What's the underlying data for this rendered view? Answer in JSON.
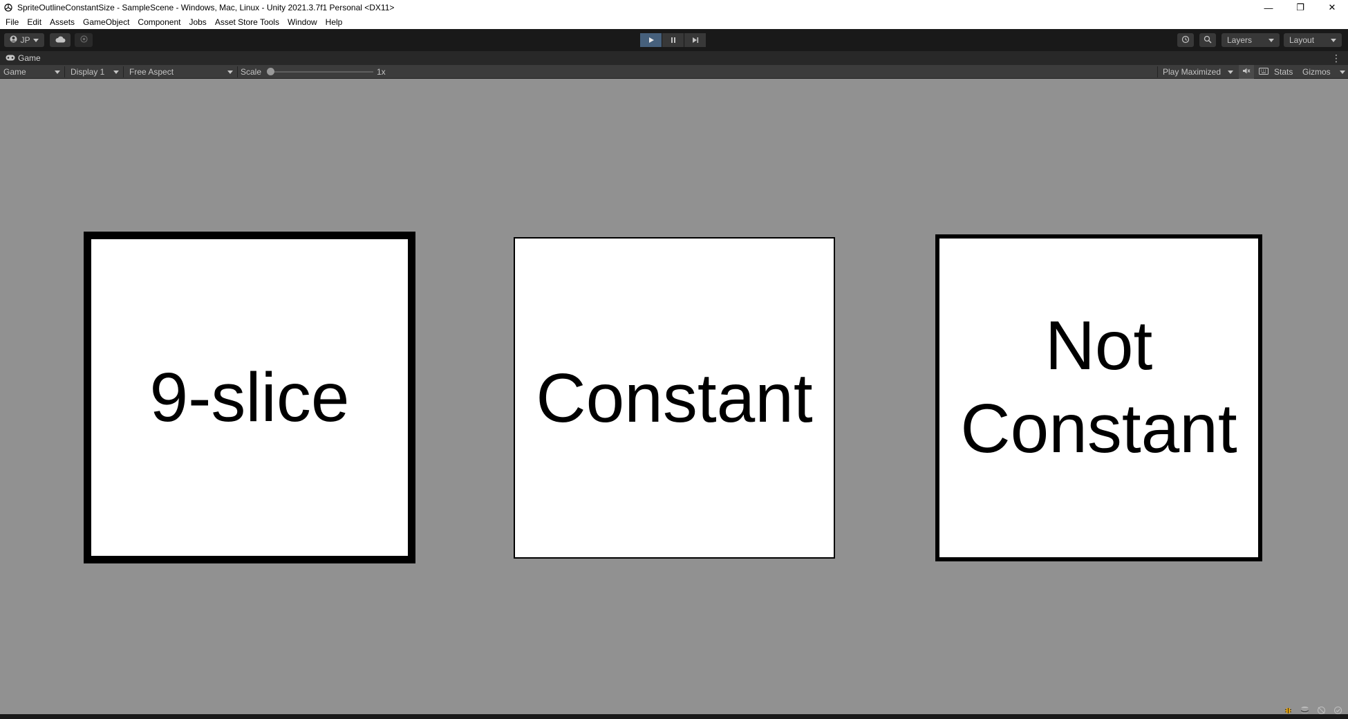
{
  "window": {
    "title": "SpriteOutlineConstantSize - SampleScene - Windows, Mac, Linux - Unity 2021.3.7f1 Personal <DX11>",
    "controls": {
      "minimize": "—",
      "restore": "❐",
      "close": "✕"
    }
  },
  "menu": [
    "File",
    "Edit",
    "Assets",
    "GameObject",
    "Component",
    "Jobs",
    "Asset Store Tools",
    "Window",
    "Help"
  ],
  "toolbar": {
    "account_label": "JP",
    "layers_label": "Layers",
    "layout_label": "Layout",
    "play_state": "playing",
    "colors": {
      "play_active": "#46607c",
      "toolbar_bg": "#191919",
      "button_bg": "#383838"
    }
  },
  "tab": {
    "label": "Game"
  },
  "game_toolbar": {
    "mode_label": "Game",
    "display_label": "Display 1",
    "aspect_label": "Free Aspect",
    "scale_label": "Scale",
    "scale_value": "1x",
    "play_mode_label": "Play Maximized",
    "stats_label": "Stats",
    "gizmos_label": "Gizmos"
  },
  "scene": {
    "background": "#919191",
    "cards": [
      {
        "name": "9-slice",
        "lines": [
          "9-slice"
        ]
      },
      {
        "name": "constant",
        "lines": [
          "Constant"
        ]
      },
      {
        "name": "not-constant",
        "lines": [
          "Not",
          "Constant"
        ]
      }
    ]
  }
}
